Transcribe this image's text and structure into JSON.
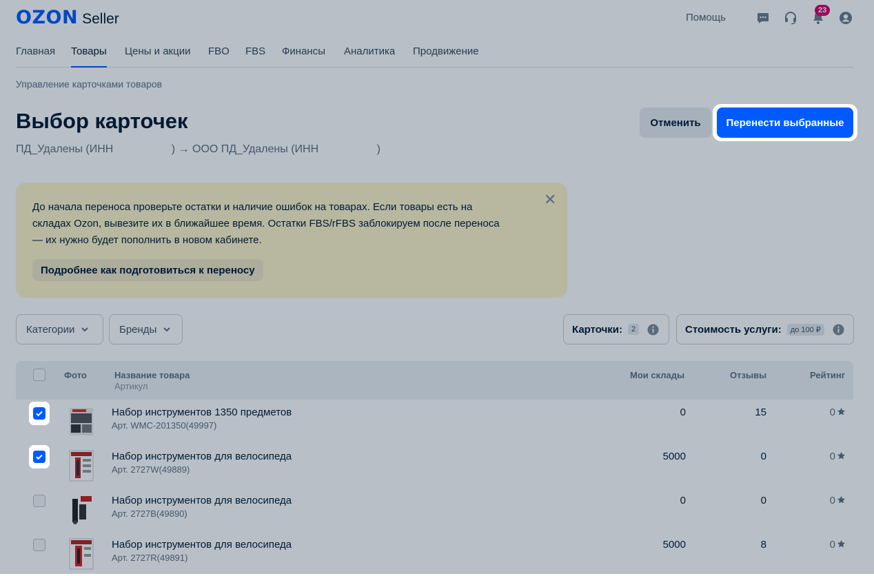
{
  "header": {
    "logo_brand": "OZON",
    "logo_product": "Seller",
    "help_label": "Помощь",
    "notifications_count": "23",
    "icons": [
      "chat-icon",
      "headset-icon",
      "bell-icon",
      "user-icon"
    ]
  },
  "nav": {
    "items": [
      {
        "label": "Главная"
      },
      {
        "label": "Товары"
      },
      {
        "label": "Цены и акции"
      },
      {
        "label": "FBO"
      },
      {
        "label": "FBS"
      },
      {
        "label": "Финансы"
      },
      {
        "label": "Аналитика"
      },
      {
        "label": "Продвижение"
      }
    ],
    "active": "Товары"
  },
  "breadcrumb": "Управление карточками товаров",
  "page": {
    "title": "Выбор карточек",
    "subtitle": "ПД_Удалены (ИНН                   ) → ООО ПД_Удалены (ИНН                   )",
    "cancel_label": "Отменить",
    "move_label": "Перенести выбранные"
  },
  "notice": {
    "text": "До начала переноса проверьте остатки и наличие ошибок на товарах. Если товары есть на складах Ozon, вывезите их в ближайшее время. Остатки FBS/rFBS заблокируем после переноса — их нужно будет пополнить в новом кабинете.",
    "button_label": "Подробнее как подготовиться к переносу",
    "bg_color": "#fff6cc"
  },
  "filters": {
    "categories_label": "Категории",
    "brands_label": "Бренды",
    "cards_label": "Карточки:",
    "cards_count": "2",
    "cost_label": "Стоимость услуги:",
    "cost_value": "до 100 ₽"
  },
  "table": {
    "headers": {
      "photo": "Фото",
      "name": "Название товара",
      "article": "Артикул",
      "stock": "Мои склады",
      "reviews": "Отзывы",
      "rating": "Рейтинг"
    },
    "rows": [
      {
        "checked": true,
        "name": "Набор инструментов 1350 предметов",
        "article": "Арт. WMC-201350(49997)",
        "stock": "0",
        "reviews": "15",
        "rating": "0"
      },
      {
        "checked": true,
        "name": "Набор инструментов для велосипеда",
        "article": "Арт. 2727W(49889)",
        "stock": "5000",
        "reviews": "0",
        "rating": "0"
      },
      {
        "checked": false,
        "name": "Набор инструментов для велосипеда",
        "article": "Арт. 2727B(49890)",
        "stock": "0",
        "reviews": "0",
        "rating": "0"
      },
      {
        "checked": false,
        "name": "Набор инструментов для велосипеда",
        "article": "Арт. 2727R(49891)",
        "stock": "5000",
        "reviews": "8",
        "rating": "0"
      }
    ]
  },
  "colors": {
    "accent": "#005bff",
    "badge": "#d6006c",
    "text": "#001a34"
  }
}
